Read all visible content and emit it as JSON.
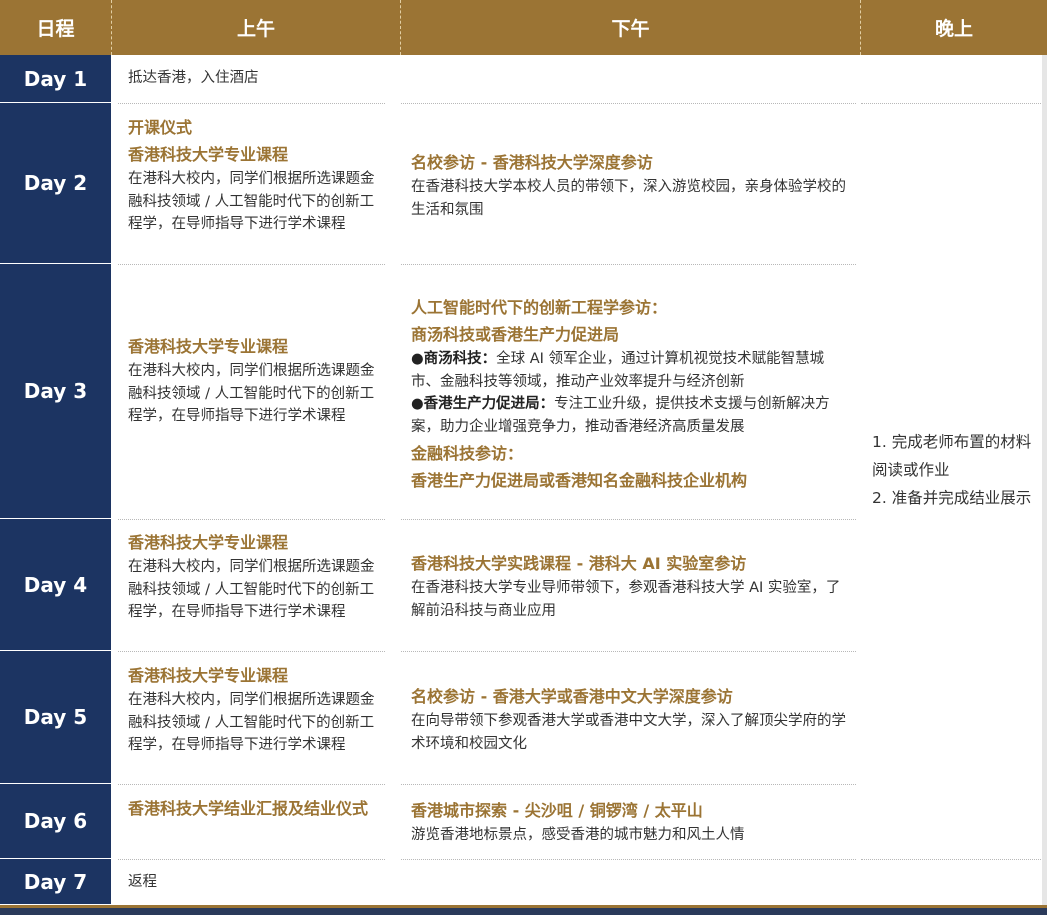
{
  "header": {
    "day": "日程",
    "morning": "上午",
    "afternoon": "下午",
    "evening": "晚上"
  },
  "days": [
    {
      "label": "Day 1",
      "morning": {
        "text": "抵达香港，入住酒店"
      },
      "afternoon": {
        "text": ""
      }
    },
    {
      "label": "Day 2",
      "morning": {
        "title1": "开课仪式",
        "title2": "香港科技大学专业课程",
        "desc": "在港科大校内，同学们根据所选课题金融科技领域 / 人工智能时代下的创新工程学，在导师指导下进行学术课程"
      },
      "afternoon": {
        "title": "名校参访 - 香港科技大学深度参访",
        "desc": "在香港科技大学本校人员的带领下，深入游览校园，亲身体验学校的生活和氛围"
      }
    },
    {
      "label": "Day 3",
      "morning": {
        "title": "香港科技大学专业课程",
        "desc": "在港科大校内，同学们根据所选课题金融科技领域 / 人工智能时代下的创新工程学，在导师指导下进行学术课程"
      },
      "afternoon": {
        "title1": "人工智能时代下的创新工程学参访：",
        "title2": "商汤科技或香港生产力促进局",
        "bullet1_title": "●商汤科技：",
        "bullet1_text": "全球 AI 领军企业，通过计算机视觉技术赋能智慧城市、金融科技等领域，推动产业效率提升与经济创新",
        "bullet2_title": "●香港生产力促进局：",
        "bullet2_text": "专注工业升级，提供技术支援与创新解决方案，助力企业增强竞争力，推动香港经济高质量发展",
        "title3": "金融科技参访：",
        "title4": "香港生产力促进局或香港知名金融科技企业机构"
      }
    },
    {
      "label": "Day 4",
      "morning": {
        "title": "香港科技大学专业课程",
        "desc": "在港科大校内，同学们根据所选课题金融科技领域 / 人工智能时代下的创新工程学，在导师指导下进行学术课程"
      },
      "afternoon": {
        "title": "香港科技大学实践课程 - 港科大 AI 实验室参访",
        "desc": "在香港科技大学专业导师带领下，参观香港科技大学 AI 实验室，了解前沿科技与商业应用"
      }
    },
    {
      "label": "Day 5",
      "morning": {
        "title": "香港科技大学专业课程",
        "desc": "在港科大校内，同学们根据所选课题金融科技领域 / 人工智能时代下的创新工程学，在导师指导下进行学术课程"
      },
      "afternoon": {
        "title": "名校参访 - 香港大学或香港中文大学深度参访",
        "desc": "在向导带领下参观香港大学或香港中文大学，深入了解顶尖学府的学术环境和校园文化"
      }
    },
    {
      "label": "Day 6",
      "morning": {
        "title": "香港科技大学结业汇报及结业仪式"
      },
      "afternoon": {
        "title": "香港城市探索 - 尖沙咀 / 铜锣湾 / 太平山",
        "desc": "游览香港地标景点，感受香港的城市魅力和风土人情"
      }
    },
    {
      "label": "Day 7",
      "morning": {
        "text": "返程"
      },
      "afternoon": {
        "text": ""
      }
    }
  ],
  "evening": {
    "item1": "1. 完成老师布置的材料阅读或作业",
    "item2": "2. 准备并完成结业展示"
  },
  "colors": {
    "header_gold": "#9b7434",
    "day_navy": "#1c3462",
    "accent_text": "#9b7434"
  }
}
